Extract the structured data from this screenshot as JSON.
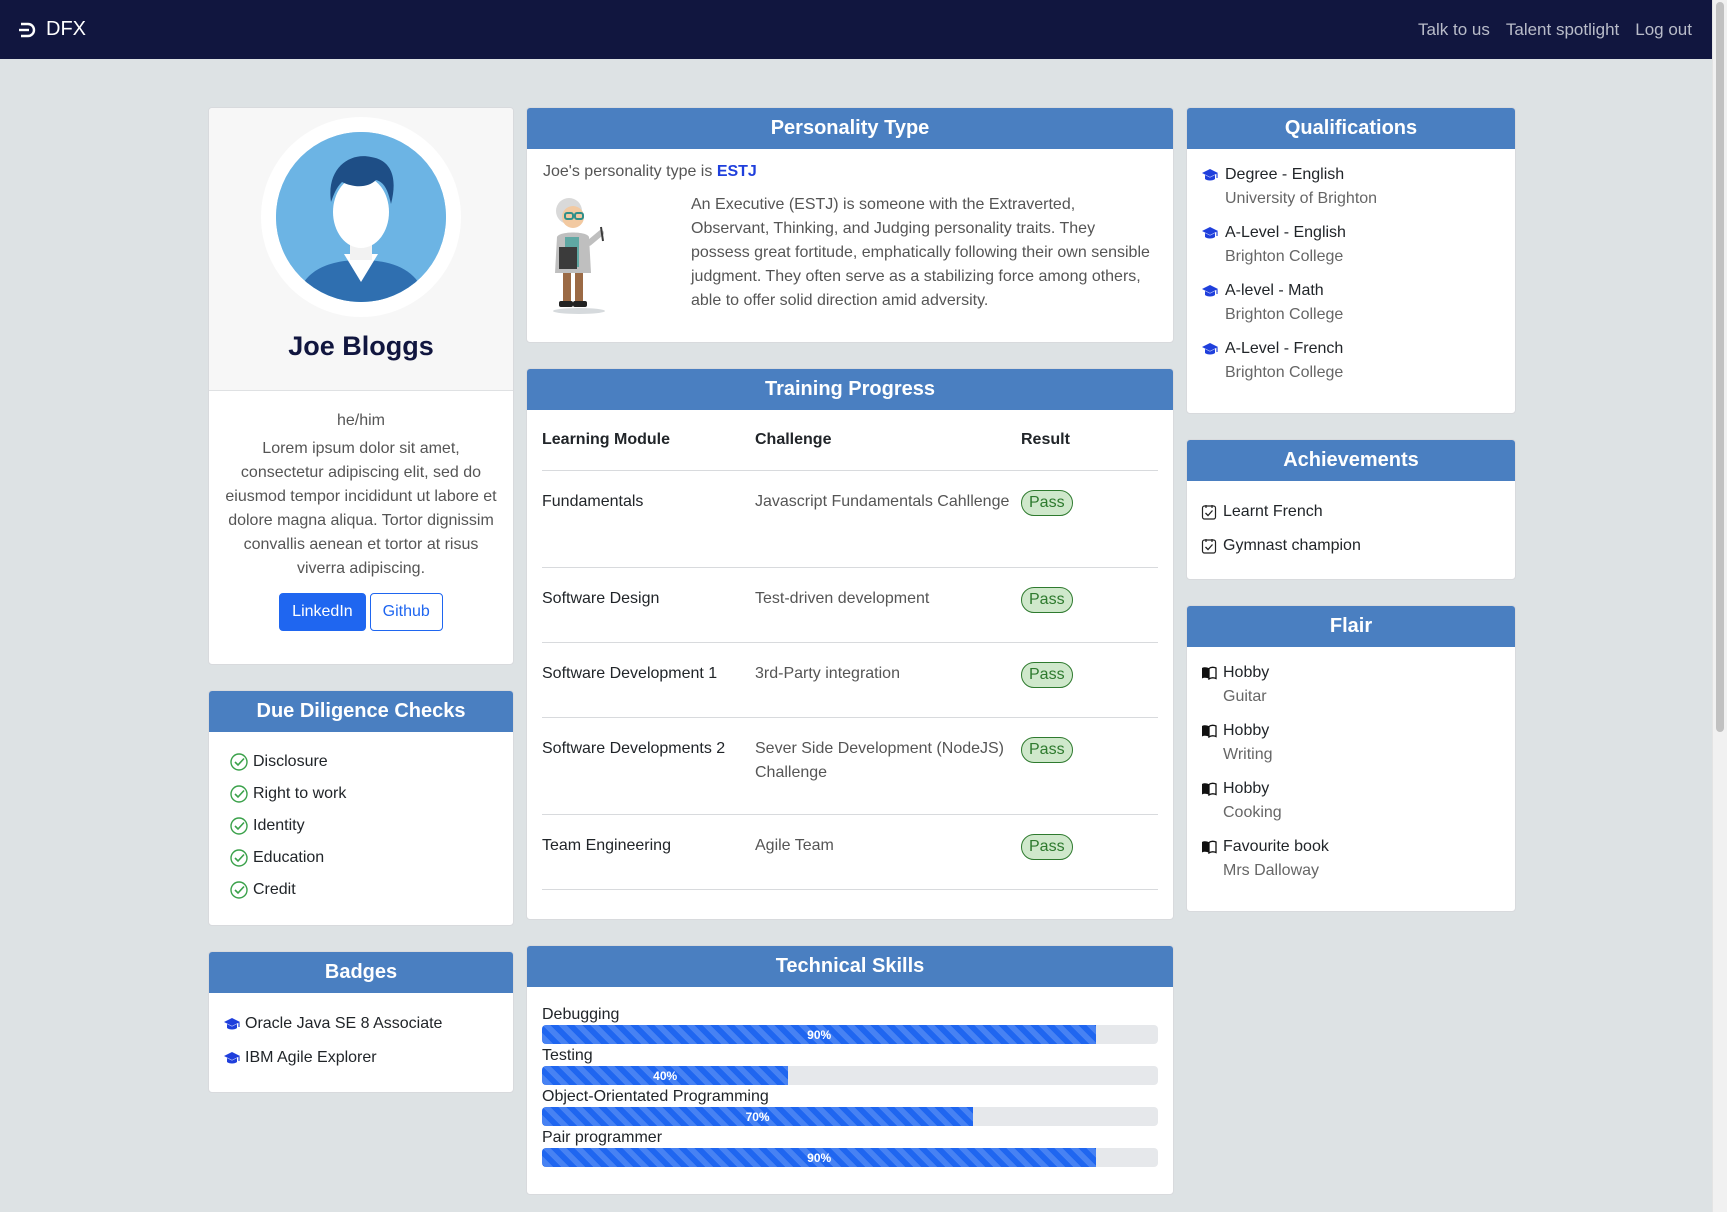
{
  "nav": {
    "brand": "DFX",
    "links": [
      "Talk to us",
      "Talent spotlight",
      "Log out"
    ]
  },
  "profile": {
    "name": "Joe Bloggs",
    "pronouns": "he/him",
    "bio": "Lorem ipsum dolor sit amet, consectetur adipiscing elit, sed do eiusmod tempor incididunt ut labore et dolore magna aliqua. Tortor dignissim convallis aenean et tortor at risus viverra adipiscing.",
    "linkedin_label": "LinkedIn",
    "github_label": "Github"
  },
  "due_diligence": {
    "title": "Due Diligence Checks",
    "items": [
      "Disclosure",
      "Right to work",
      "Identity",
      "Education",
      "Credit"
    ]
  },
  "badges": {
    "title": "Badges",
    "items": [
      "Oracle Java SE 8 Associate",
      "IBM Agile Explorer"
    ]
  },
  "personality": {
    "title": "Personality Type",
    "intro": "Joe's personality type is ",
    "type": "ESTJ",
    "description": "An Executive (ESTJ) is someone with the Extraverted, Observant, Thinking, and Judging personality traits. They possess great fortitude, emphatically following their own sensible judgment. They often serve as a stabilizing force among others, able to offer solid direction amid adversity."
  },
  "training": {
    "title": "Training Progress",
    "headers": [
      "Learning Module",
      "Challenge",
      "Result"
    ],
    "rows": [
      {
        "module": "Fundamentals",
        "challenge": "Javascript Fundamentals Cahllenge",
        "result": "Pass"
      },
      {
        "module": "Software Design",
        "challenge": "Test-driven development",
        "result": "Pass"
      },
      {
        "module": "Software Development 1",
        "challenge": "3rd-Party integration",
        "result": "Pass"
      },
      {
        "module": "Software Developments 2",
        "challenge": "Sever Side Development (NodeJS) Challenge",
        "result": "Pass"
      },
      {
        "module": "Team Engineering",
        "challenge": "Agile Team",
        "result": "Pass"
      }
    ]
  },
  "skills": {
    "title": "Technical Skills",
    "items": [
      {
        "name": "Debugging",
        "value": 90,
        "label": "90%"
      },
      {
        "name": "Testing",
        "value": 40,
        "label": "40%"
      },
      {
        "name": "Object-Orientated Programming",
        "value": 70,
        "label": "70%"
      },
      {
        "name": "Pair programmer",
        "value": 90,
        "label": "90%"
      }
    ]
  },
  "qualifications": {
    "title": "Qualifications",
    "items": [
      {
        "title": "Degree - English",
        "institution": "University of Brighton"
      },
      {
        "title": "A-Level - English",
        "institution": "Brighton College"
      },
      {
        "title": "A-level - Math",
        "institution": "Brighton College"
      },
      {
        "title": "A-Level - French",
        "institution": "Brighton College"
      }
    ]
  },
  "achievements": {
    "title": "Achievements",
    "items": [
      "Learnt French",
      "Gymnast champion"
    ]
  },
  "flair": {
    "title": "Flair",
    "items": [
      {
        "title": "Hobby",
        "value": "Guitar"
      },
      {
        "title": "Hobby",
        "value": "Writing"
      },
      {
        "title": "Hobby",
        "value": "Cooking"
      },
      {
        "title": "Favourite book",
        "value": "Mrs Dalloway"
      }
    ]
  },
  "colors": {
    "navbar": "#11163f",
    "card_header": "#4a7fc1",
    "primary": "#1f66f0",
    "pass_bg": "#cfe8cb",
    "pass_text": "#2e7a2e",
    "background": "#dde2e4"
  }
}
